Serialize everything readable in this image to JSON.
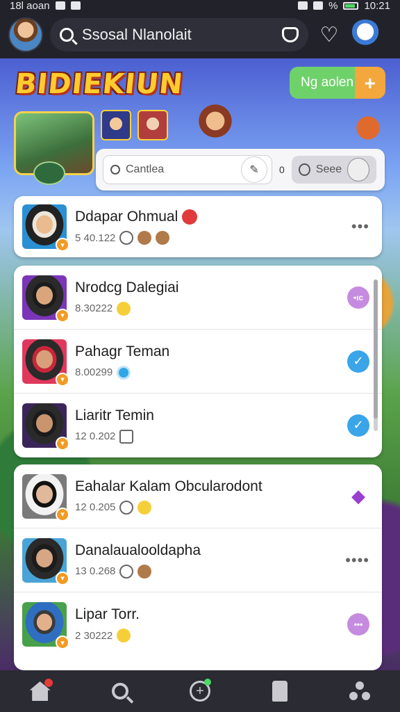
{
  "status_bar": {
    "left_text": "18l aoan",
    "right_text": "%",
    "time": "10:21"
  },
  "top_bar": {
    "search_text": "Ssosal Nlanolait"
  },
  "scene": {
    "logo": "BIDIEKIUN",
    "new_button_label": "Ng aolen",
    "new_button_plus": "+"
  },
  "filter": {
    "input_placeholder": "Cantlea",
    "count": "0",
    "seen_label": "Seee"
  },
  "contacts": [
    {
      "name": "Ddapar Ohmual",
      "meta": "5 40.122",
      "action": "more",
      "action_text": "•••"
    },
    {
      "name": "Nrodcg Dalegiai",
      "meta": "8.30222",
      "action": "pill",
      "action_text": "•ıc"
    },
    {
      "name": "Pahagr Teman",
      "meta": "8.00299",
      "action": "check",
      "action_text": "✓"
    },
    {
      "name": "Liaritr Temin",
      "meta": "12 0.202",
      "action": "check",
      "action_text": "✓"
    },
    {
      "name": "Eahalar Kalam Obcularodont",
      "meta": "12 0.205",
      "action": "diamond",
      "action_text": "◆"
    },
    {
      "name": "Danalaualooldapha",
      "meta": "13 0.268",
      "action": "more",
      "action_text": "••••"
    },
    {
      "name": "Lipar Torr.",
      "meta": "2 30222",
      "action": "pill",
      "action_text": "•••"
    }
  ],
  "bottom_nav": [
    {
      "label": "home"
    },
    {
      "label": "search"
    },
    {
      "label": "add"
    },
    {
      "label": "stage"
    },
    {
      "label": "groups"
    }
  ]
}
